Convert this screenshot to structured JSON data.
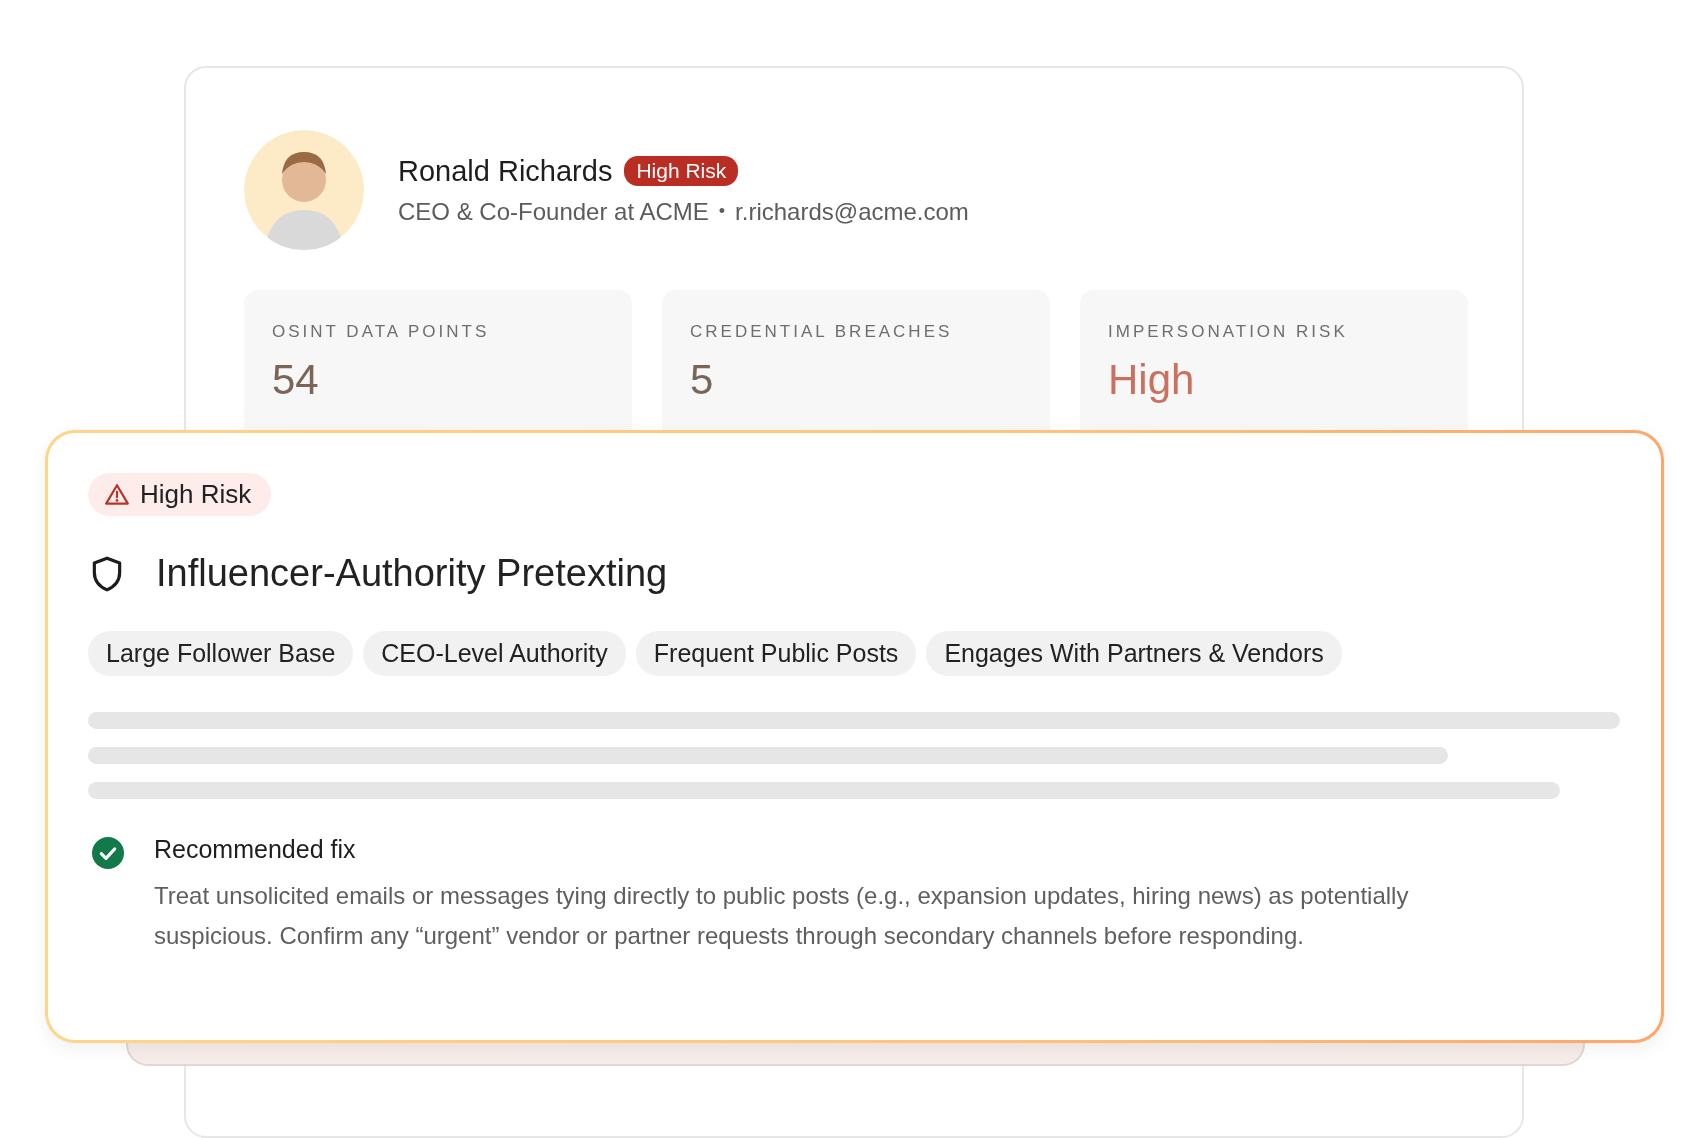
{
  "profile": {
    "name": "Ronald Richards",
    "badge": "High Risk",
    "role": "CEO & Co-Founder at ACME",
    "separator": "•",
    "email": "r.richards@acme.com"
  },
  "stats": [
    {
      "label": "OSINT DATA POINTS",
      "value": "54",
      "color": "#7a6557"
    },
    {
      "label": "CREDENTIAL BREACHES",
      "value": "5",
      "color": "#7a6557"
    },
    {
      "label": "IMPERSONATION RISK",
      "value": "High",
      "color": "#c9705f"
    }
  ],
  "finding": {
    "risk": "High Risk",
    "title": "Influencer-Authority Pretexting",
    "tags": [
      "Large Follower Base",
      "CEO-Level Authority",
      "Frequent Public Posts",
      "Engages With Partners & Vendors"
    ],
    "fix": {
      "heading": "Recommended fix",
      "text": "Treat unsolicited emails or messages tying directly to public posts (e.g., expansion updates, hiring news) as potentially suspicious. Confirm any “urgent” vendor or partner requests through secondary channels before responding."
    }
  }
}
